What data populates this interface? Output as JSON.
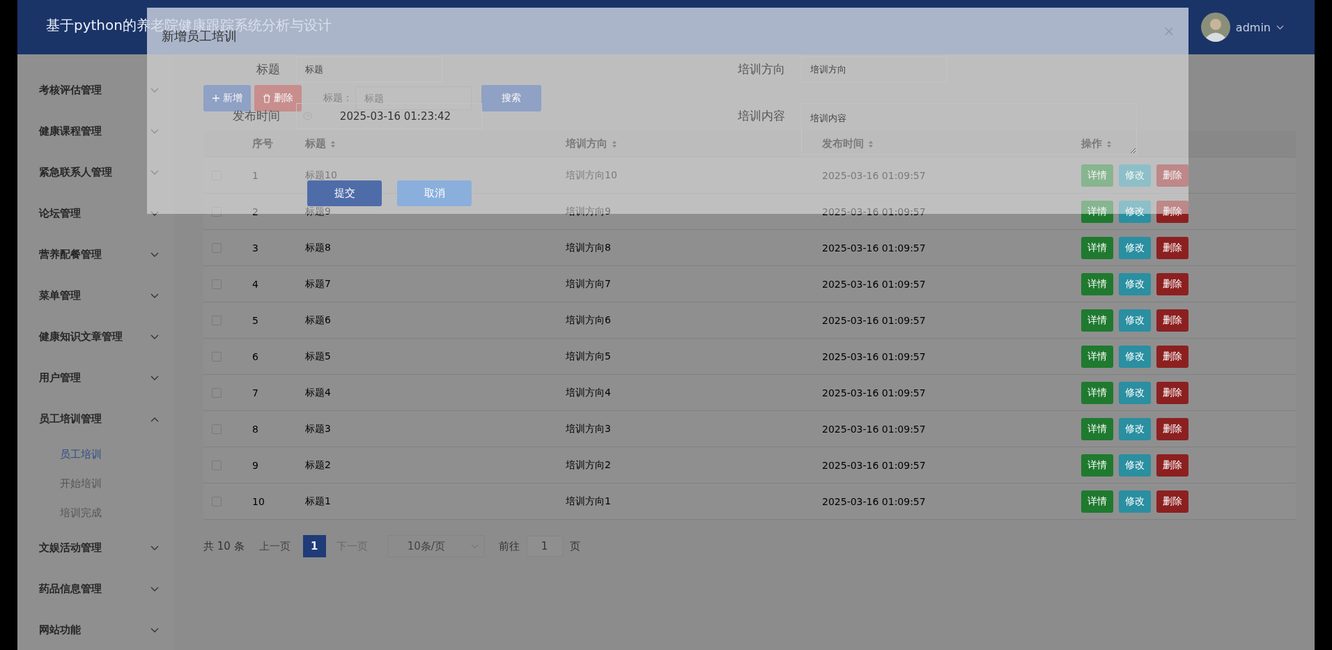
{
  "header": {
    "title": "基于python的养老院健康跟踪系统分析与设计",
    "user": "admin"
  },
  "sidebar": {
    "items": [
      {
        "label": "考核评估管理",
        "expanded": false
      },
      {
        "label": "健康课程管理",
        "expanded": false
      },
      {
        "label": "紧急联系人管理",
        "expanded": false
      },
      {
        "label": "论坛管理",
        "expanded": false
      },
      {
        "label": "营养配餐管理",
        "expanded": false
      },
      {
        "label": "菜单管理",
        "expanded": false
      },
      {
        "label": "健康知识文章管理",
        "expanded": false
      },
      {
        "label": "用户管理",
        "expanded": false
      },
      {
        "label": "员工培训管理",
        "expanded": true,
        "children": [
          {
            "label": "员工培训",
            "selected": true
          },
          {
            "label": "开始培训",
            "selected": false
          },
          {
            "label": "培训完成",
            "selected": false
          }
        ]
      },
      {
        "label": "文娱活动管理",
        "expanded": false
      },
      {
        "label": "药品信息管理",
        "expanded": false
      },
      {
        "label": "网站功能",
        "expanded": false
      }
    ]
  },
  "toolbar": {
    "add_button": "新增",
    "delete_button": "删除",
    "search_label": "标题：",
    "search_field": {
      "placeholder": "标题"
    },
    "search_button": "搜索"
  },
  "table": {
    "columns": [
      {
        "label": "序号",
        "sortable": false
      },
      {
        "label": "标题",
        "sortable": true
      },
      {
        "label": "培训方向",
        "sortable": true
      },
      {
        "label": "发布时间",
        "sortable": true
      },
      {
        "label": "操作",
        "sortable": true
      }
    ],
    "rows": [
      {
        "checked": false,
        "cells": [
          "1",
          "标题10",
          "培训方向10",
          "2025-03-16 01:09:57"
        ],
        "actions": [
          {
            "kind": "detail",
            "label": "详情"
          },
          {
            "kind": "edit",
            "label": "修改"
          },
          {
            "kind": "delete",
            "label": "删除"
          }
        ]
      },
      {
        "checked": false,
        "cells": [
          "2",
          "标题9",
          "培训方向9",
          "2025-03-16 01:09:57"
        ],
        "actions": [
          {
            "kind": "detail",
            "label": "详情"
          },
          {
            "kind": "edit",
            "label": "修改"
          },
          {
            "kind": "delete",
            "label": "删除"
          }
        ]
      },
      {
        "checked": false,
        "cells": [
          "3",
          "标题8",
          "培训方向8",
          "2025-03-16 01:09:57"
        ],
        "actions": [
          {
            "kind": "detail",
            "label": "详情"
          },
          {
            "kind": "edit",
            "label": "修改"
          },
          {
            "kind": "delete",
            "label": "删除"
          }
        ]
      },
      {
        "checked": false,
        "cells": [
          "4",
          "标题7",
          "培训方向7",
          "2025-03-16 01:09:57"
        ],
        "actions": [
          {
            "kind": "detail",
            "label": "详情"
          },
          {
            "kind": "edit",
            "label": "修改"
          },
          {
            "kind": "delete",
            "label": "删除"
          }
        ]
      },
      {
        "checked": false,
        "cells": [
          "5",
          "标题6",
          "培训方向6",
          "2025-03-16 01:09:57"
        ],
        "actions": [
          {
            "kind": "detail",
            "label": "详情"
          },
          {
            "kind": "edit",
            "label": "修改"
          },
          {
            "kind": "delete",
            "label": "删除"
          }
        ]
      },
      {
        "checked": false,
        "cells": [
          "6",
          "标题5",
          "培训方向5",
          "2025-03-16 01:09:57"
        ],
        "actions": [
          {
            "kind": "detail",
            "label": "详情"
          },
          {
            "kind": "edit",
            "label": "修改"
          },
          {
            "kind": "delete",
            "label": "删除"
          }
        ]
      },
      {
        "checked": false,
        "cells": [
          "7",
          "标题4",
          "培训方向4",
          "2025-03-16 01:09:57"
        ],
        "actions": [
          {
            "kind": "detail",
            "label": "详情"
          },
          {
            "kind": "edit",
            "label": "修改"
          },
          {
            "kind": "delete",
            "label": "删除"
          }
        ]
      },
      {
        "checked": false,
        "cells": [
          "8",
          "标题3",
          "培训方向3",
          "2025-03-16 01:09:57"
        ],
        "actions": [
          {
            "kind": "detail",
            "label": "详情"
          },
          {
            "kind": "edit",
            "label": "修改"
          },
          {
            "kind": "delete",
            "label": "删除"
          }
        ]
      },
      {
        "checked": false,
        "cells": [
          "9",
          "标题2",
          "培训方向2",
          "2025-03-16 01:09:57"
        ],
        "actions": [
          {
            "kind": "detail",
            "label": "详情"
          },
          {
            "kind": "edit",
            "label": "修改"
          },
          {
            "kind": "delete",
            "label": "删除"
          }
        ]
      },
      {
        "checked": false,
        "cells": [
          "10",
          "标题1",
          "培训方向1",
          "2025-03-16 01:09:57"
        ],
        "actions": [
          {
            "kind": "detail",
            "label": "详情"
          },
          {
            "kind": "edit",
            "label": "修改"
          },
          {
            "kind": "delete",
            "label": "删除"
          }
        ]
      }
    ]
  },
  "pagination": {
    "total": "共 10 条",
    "prev": "上一页",
    "pages": [
      {
        "label": "1",
        "selected": true
      }
    ],
    "next": "下一页",
    "page_size": "10条/页",
    "goto_label": "前往",
    "goto_value": "1",
    "page_suffix": "页"
  },
  "dialog": {
    "title": "新增员工培训",
    "fields": [
      {
        "kind": "text",
        "label": "标题",
        "placeholder": "标题"
      },
      {
        "kind": "text",
        "label": "培训方向",
        "placeholder": "培训方向"
      },
      {
        "kind": "datetime",
        "label": "发布时间",
        "value": "2025-03-16 01:23:42"
      },
      {
        "kind": "textarea",
        "label": "培训内容",
        "placeholder": "培训内容"
      }
    ],
    "buttons": [
      {
        "kind": "primary",
        "label": "提交"
      },
      {
        "kind": "secondary",
        "label": "取消"
      }
    ]
  }
}
